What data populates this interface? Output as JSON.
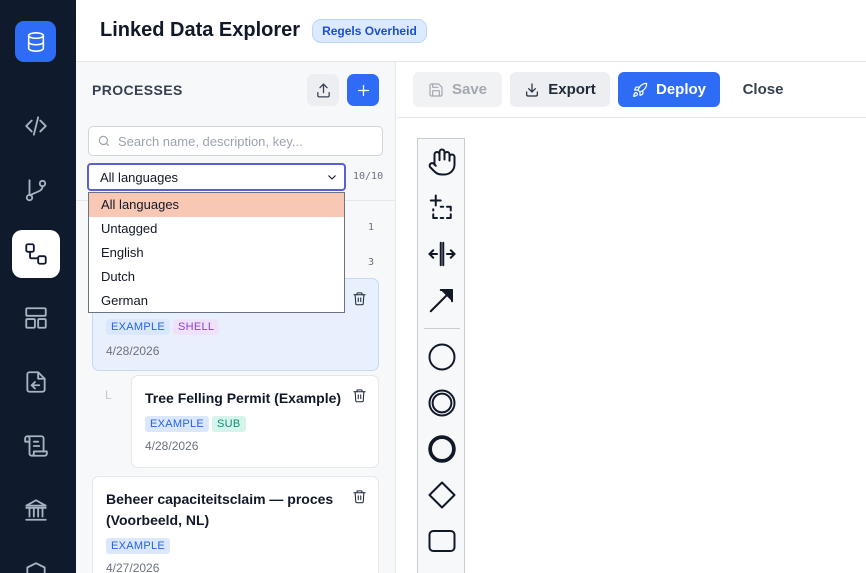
{
  "app": {
    "title": "Linked Data Explorer",
    "badge": "Regels Overheid"
  },
  "rail": {
    "items": [
      {
        "name": "database-icon",
        "active": false
      },
      {
        "name": "code-icon",
        "active": false
      },
      {
        "name": "git-branch-icon",
        "active": false
      },
      {
        "name": "workflow-icon",
        "active": true
      },
      {
        "name": "layout-icon",
        "active": false
      },
      {
        "name": "import-icon",
        "active": false
      },
      {
        "name": "scroll-icon",
        "active": false
      },
      {
        "name": "bank-icon",
        "active": false
      },
      {
        "name": "shield-icon",
        "active": false
      }
    ]
  },
  "processes": {
    "title": "PROCESSES",
    "search_placeholder": "Search name, description, key...",
    "language_filter": {
      "selected": "All languages",
      "options": [
        "All languages",
        "Untagged",
        "English",
        "Dutch",
        "German"
      ]
    },
    "count": "10/10",
    "side_numbers": [
      "1",
      "3"
    ],
    "items": [
      {
        "title": "",
        "tags": [
          "EXAMPLE",
          "SHELL"
        ],
        "date": "4/28/2026",
        "selected": true
      },
      {
        "title": "Tree Felling Permit (Example)",
        "tags": [
          "EXAMPLE",
          "SUB"
        ],
        "date": "4/28/2026",
        "selected": false,
        "child": true
      },
      {
        "title_line1": "Beheer capaciteitsclaim — proces",
        "title_line2": "(Voorbeeld, NL)",
        "tags": [
          "EXAMPLE"
        ],
        "date": "4/27/2026",
        "selected": false
      }
    ],
    "tree_mark": "L"
  },
  "toolbar": {
    "save_label": "Save",
    "export_label": "Export",
    "deploy_label": "Deploy",
    "close_label": "Close"
  },
  "palette": {
    "tools": [
      "hand-tool-icon",
      "lasso-tool-icon",
      "space-tool-icon",
      "connect-tool-icon",
      "start-event-icon",
      "intermediate-event-icon",
      "end-event-icon",
      "gateway-icon",
      "task-icon"
    ]
  },
  "colors": {
    "accent": "#2f6cf6",
    "rail_bg": "#0f1b2d",
    "dropdown_highlight": "#f9c8b5"
  }
}
